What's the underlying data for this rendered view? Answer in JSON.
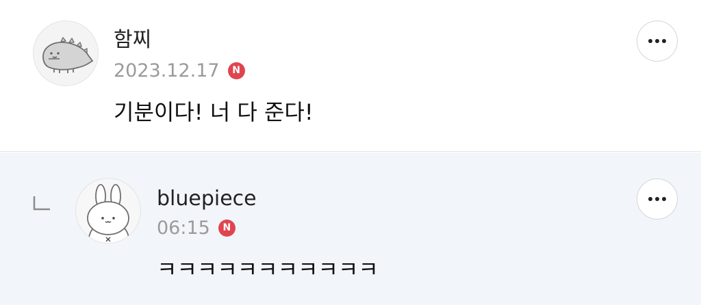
{
  "comments": [
    {
      "author": "함찌",
      "date": "2023.12.17",
      "badge": "N",
      "text": "기분이다! 너 다 준다!",
      "more_icon": "more-horizontal-icon",
      "avatar": "gray-dinosaur-avatar"
    },
    {
      "author": "bluepiece",
      "date": "06:15",
      "badge": "N",
      "text": "ㅋㅋㅋㅋㅋㅋㅋㅋㅋㅋㅋ",
      "more_icon": "more-horizontal-icon",
      "avatar": "white-bunny-avatar",
      "reply_icon": "reply-arrow-icon"
    }
  ],
  "colors": {
    "reply_background": "#f2f6fa",
    "new_badge": "#e0454f",
    "date_text": "#9a9a9a"
  }
}
